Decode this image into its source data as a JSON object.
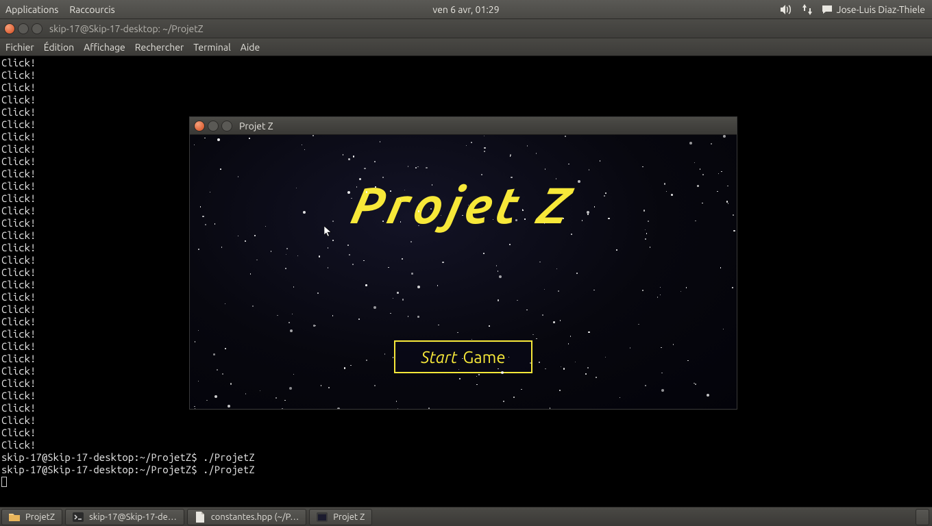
{
  "panel": {
    "applications": "Applications",
    "shortcuts": "Raccourcis",
    "clock": "ven  6 avr, 01:29",
    "user": "Jose-Luis Diaz-Thiele"
  },
  "terminal": {
    "title": "skip-17@Skip-17-desktop: ~/ProjetZ",
    "menubar": {
      "file": "Fichier",
      "edit": "Édition",
      "view": "Affichage",
      "search": "Rechercher",
      "terminal": "Terminal",
      "help": "Aide"
    },
    "click_line": "Click!",
    "click_count": 32,
    "prompt": "skip-17@Skip-17-desktop:~/ProjetZ$ ",
    "command": "./ProjetZ"
  },
  "game": {
    "window_title": "Projet Z",
    "title": "Projet Z",
    "start_italic": "Start",
    "start_plain": "Game"
  },
  "taskbar": {
    "items": [
      {
        "icon": "folder",
        "label": "ProjetZ"
      },
      {
        "icon": "terminal",
        "label": "skip-17@Skip-17-de…"
      },
      {
        "icon": "doc",
        "label": "constantes.hpp (~/P…"
      },
      {
        "icon": "app",
        "label": "Projet Z"
      }
    ]
  }
}
